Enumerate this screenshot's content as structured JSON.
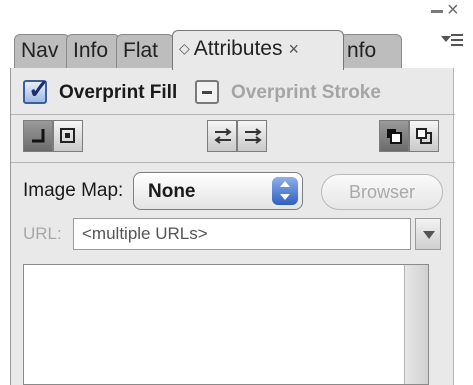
{
  "tabs": [
    {
      "label": "Nav"
    },
    {
      "label": "Info"
    },
    {
      "label": "Flat"
    },
    {
      "label": "Attributes",
      "active": true
    },
    {
      "label": "nfo"
    }
  ],
  "overprint": {
    "fill_label": "Overprint Fill",
    "fill_checked": true,
    "stroke_label": "Overprint Stroke",
    "stroke_state": "mixed"
  },
  "toolbar": {
    "icons": [
      "show-all-icon",
      "show-one-icon",
      "transpose-left-icon",
      "transpose-right-icon",
      "bring-forward-icon",
      "send-backward-icon"
    ]
  },
  "image_map": {
    "label": "Image Map:",
    "value": "None",
    "browser_label": "Browser"
  },
  "url": {
    "label": "URL:",
    "value": "<multiple URLs>"
  },
  "colors": {
    "accent": "#2f5fc0",
    "panel_bg": "#e9e9e9",
    "disabled_text": "#a8a8a8"
  }
}
